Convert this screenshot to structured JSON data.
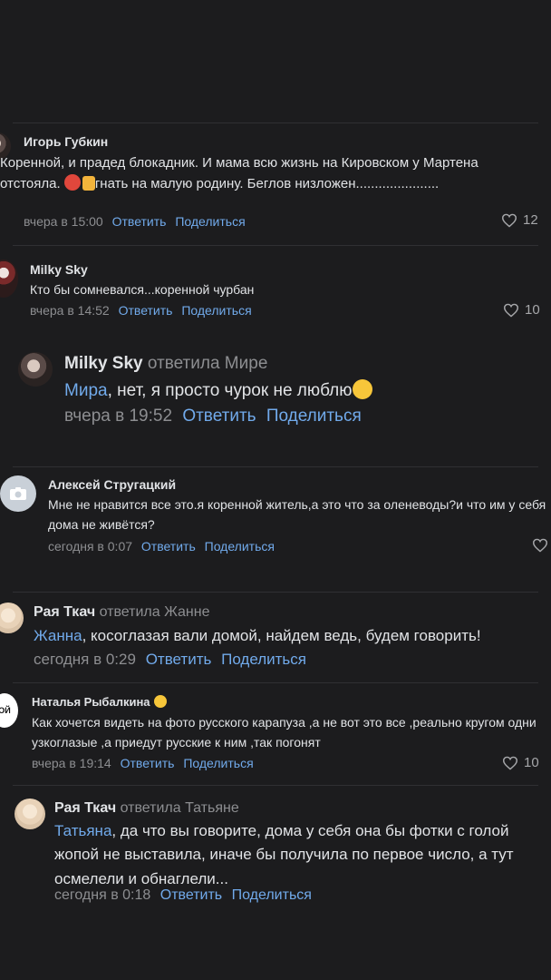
{
  "actions": {
    "reply": "Ответить",
    "share": "Поделиться"
  },
  "comments": [
    {
      "author": "Игорь Губкин",
      "text_a": "Коренной, и прадед блокадник. И мама всю жизнь на Кировском у Мартена отстояла. ",
      "text_b": "гнать на малую родину. Беглов низложен......................",
      "time": "вчера в 15:00",
      "likes": "12",
      "emoji": [
        "angry-face-icon",
        "thumbs-down-icon"
      ]
    },
    {
      "author": "Milky Sky",
      "text": "Кто бы сомневался...коренной чурбан",
      "time": "вчера в 14:52",
      "likes": "10"
    },
    {
      "author": "Milky Sky",
      "reply_to": "ответила Мире",
      "mention": "Мира",
      "text": ", нет, я просто чурок не люблю",
      "time": "вчера в 19:52",
      "emoji": [
        "rolling-laughing-icon"
      ]
    },
    {
      "author": "Алексей Стругацкий",
      "text": "Мне не нравится все это.я коренной житель,а это что за оленеводы?и что им у себя дома не живётся?",
      "time": "сегодня в 0:07"
    },
    {
      "author": "Рая Ткач",
      "reply_to": "ответила Жанне",
      "mention": "Жанна",
      "text": ", косоглазая вали домой, найдем ведь, будем говорить!",
      "time": "сегодня в 0:29"
    },
    {
      "author": "Наталья Рыбалкина",
      "text": "Как хочется видеть на фото русского карапуза ,а не вот это все ,реально кругом одни узкоглазые ,а приедут русские к ним ,так погонят",
      "time": "вчера в 19:14",
      "likes": "10",
      "emoji": [
        "smiling-face-icon"
      ],
      "avatar_text": "ОЙ"
    },
    {
      "author": "Рая Ткач",
      "reply_to": "ответила Татьяне",
      "mention": "Татьяна",
      "text": ", да что вы говорите, дома у себя она бы фотки с голой жопой не выставила, иначе бы получила по первое число, а тут осмелели и обнаглели...",
      "time": "сегодня в 0:18"
    }
  ]
}
